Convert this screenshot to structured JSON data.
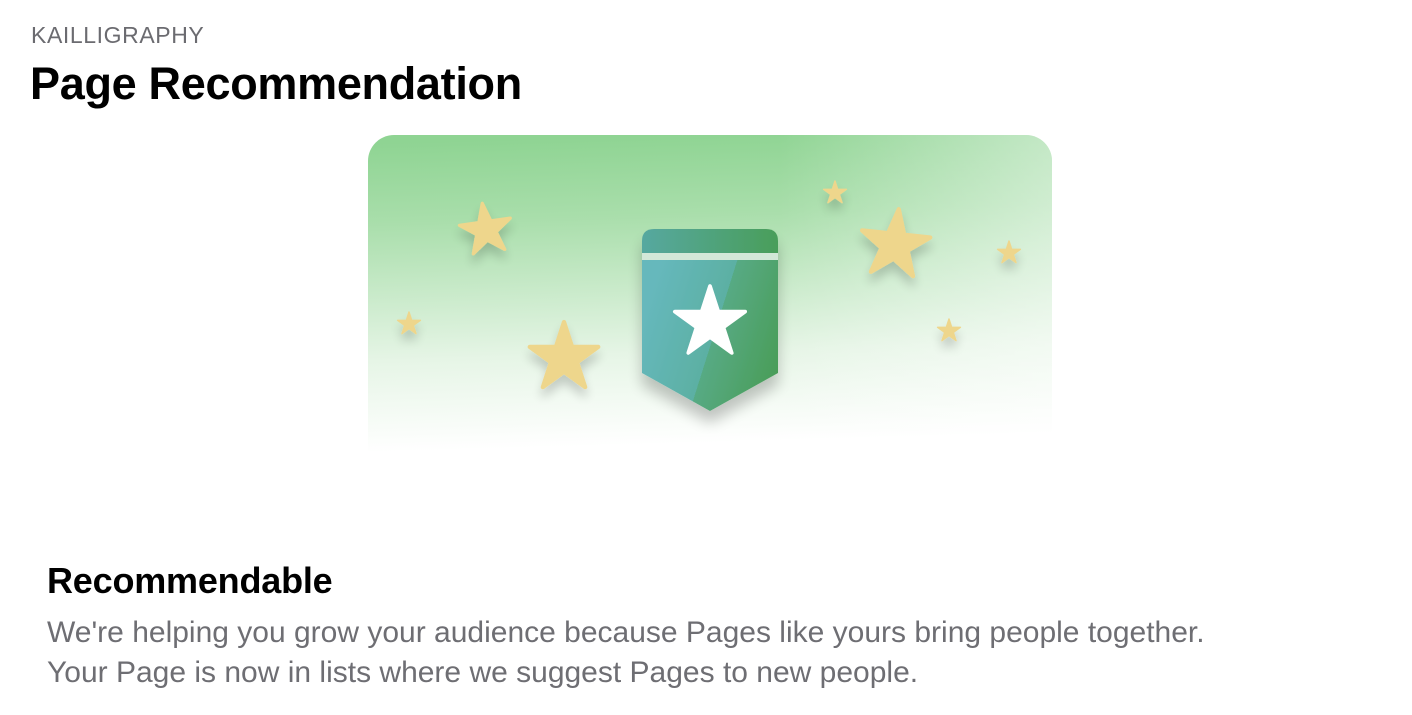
{
  "header": {
    "eyebrow": "KAILLIGRAPHY",
    "title": "Page Recommendation"
  },
  "illustration": {
    "icon": "recommendation-badge-star-icon",
    "decoration_icon": "star-icon",
    "colors": {
      "background_green": "#8fd493",
      "star_yellow": "#eed68c",
      "badge_teal": "#62b6b7",
      "badge_green": "#4fa05f"
    }
  },
  "content": {
    "heading": "Recommendable",
    "line1": "We're helping you grow your audience because Pages like yours bring people together.",
    "line2": "Your Page is now in lists where we suggest Pages to new people."
  }
}
